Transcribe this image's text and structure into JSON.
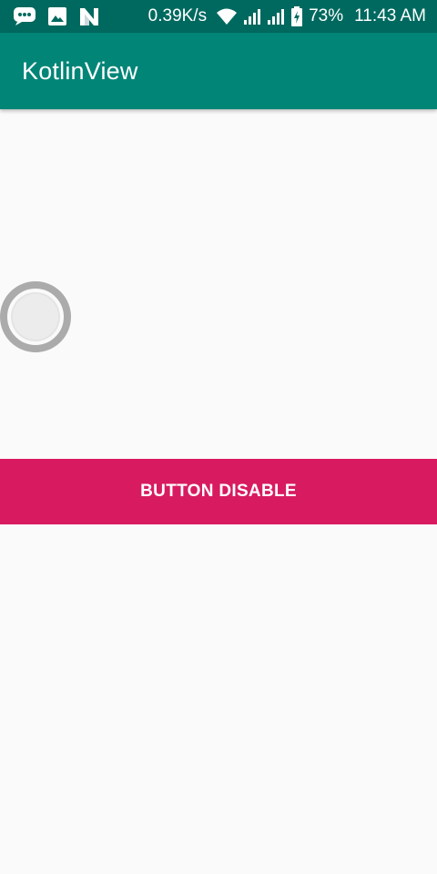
{
  "status_bar": {
    "net_speed": "0.39K/s",
    "battery_percent": "73%",
    "time": "11:43 AM",
    "icons": [
      "message-icon",
      "image-icon",
      "n-notification-icon",
      "wifi-icon",
      "signal-icon",
      "signal-icon-2",
      "battery-charging-icon"
    ]
  },
  "app_bar": {
    "title": "KotlinView",
    "color": "#008577"
  },
  "main": {
    "toggle_state": "off",
    "button_label": "BUTTON DISABLE",
    "button_color": "#d81b60"
  }
}
